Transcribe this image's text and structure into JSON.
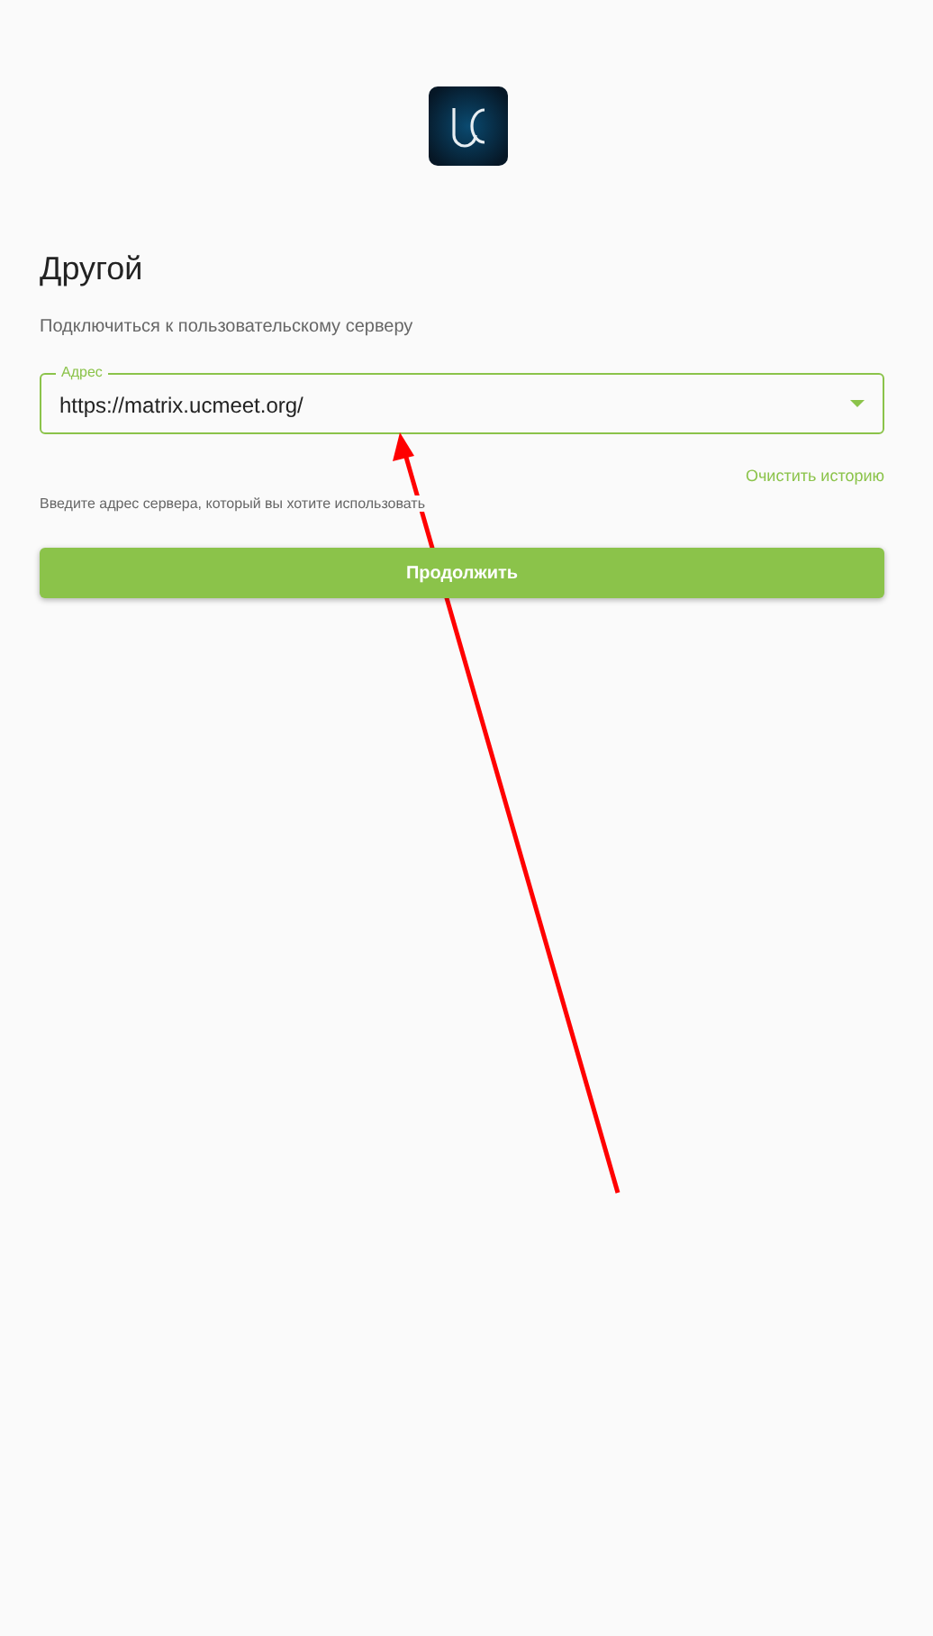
{
  "title": "Другой",
  "subtitle": "Подключиться к пользовательскому серверу",
  "address_field": {
    "label": "Адрес",
    "value": "https://matrix.ucmeet.org/"
  },
  "clear_history_link": "Очистить историю",
  "helper_text": "Введите адрес сервера, который вы хотите использовать",
  "continue_button": "Продолжить"
}
